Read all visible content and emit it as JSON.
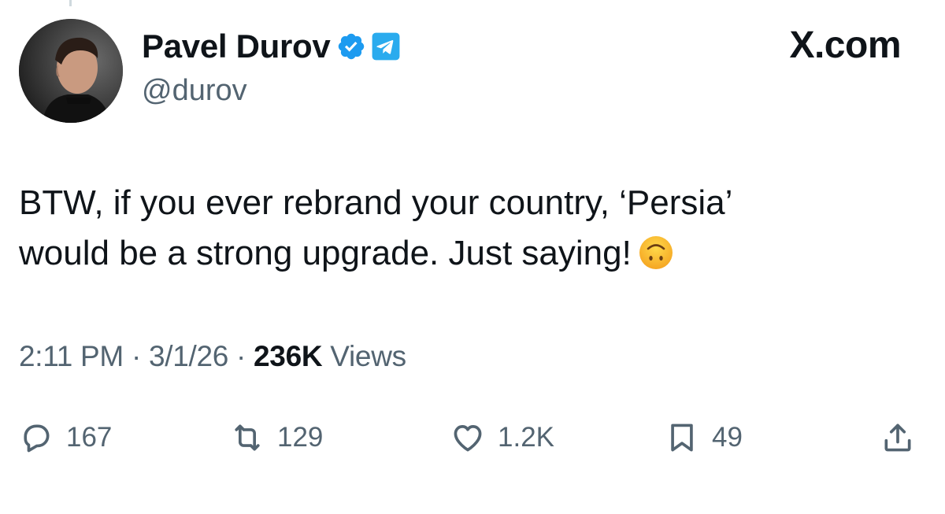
{
  "author": {
    "display_name": "Pavel Durov",
    "handle": "@durov",
    "verified_icon": "verified-badge-icon",
    "affiliation_icon": "telegram-icon",
    "verified_color": "#1d9bf0",
    "telegram_color": "#2aabee"
  },
  "brand": "X.com",
  "tweet": {
    "text": "BTW, if you ever rebrand your country, ‘Persia’\nwould be a strong upgrade. Just saying!",
    "emoji": "upside-down-face-emoji"
  },
  "meta": {
    "time": "2:11 PM",
    "separator": "·",
    "date": "3/1/26",
    "views_count": "236K",
    "views_label": "Views"
  },
  "actions": {
    "replies": "167",
    "reposts": "129",
    "likes": "1.2K",
    "bookmarks": "49"
  }
}
